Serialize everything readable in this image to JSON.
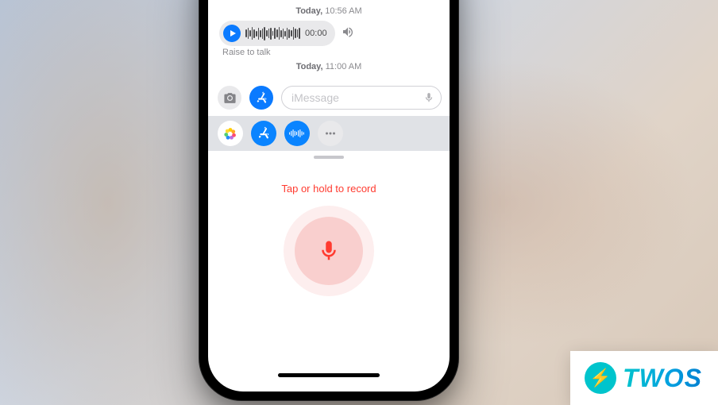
{
  "conversation": {
    "timestamps": {
      "t1_day": "Today,",
      "t1_time": "10:56 AM",
      "t2_day": "Today,",
      "t2_time": "11:00 AM"
    },
    "audio_message": {
      "duration": "00:00",
      "caption": "Raise to talk"
    }
  },
  "compose": {
    "placeholder": "iMessage"
  },
  "app_strip": {
    "items": [
      "photos",
      "app-store",
      "audio-message",
      "more"
    ]
  },
  "record": {
    "hint": "Tap or hold to record"
  },
  "watermark": {
    "text": "TWOS"
  },
  "colors": {
    "accent_blue": "#0a7aff",
    "accent_red": "#ff3b30",
    "teal": "#00c4cc"
  }
}
